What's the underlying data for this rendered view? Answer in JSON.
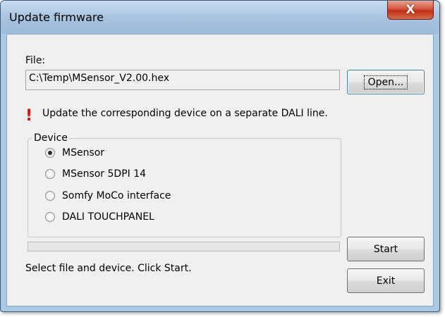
{
  "window": {
    "title": "Update firmware",
    "close_glyph": "X"
  },
  "file": {
    "label": "File:",
    "path": "C:\\Temp\\MSensor_V2.00.hex",
    "open_button": "Open..."
  },
  "warning": {
    "icon": "exclamation-icon",
    "text": "Update the corresponding device on a separate DALI line."
  },
  "device": {
    "group_label": "Device",
    "options": [
      "MSensor",
      "MSensor 5DPI 14",
      "Somfy MoCo interface",
      "DALI TOUCHPANEL"
    ],
    "selected": "MSensor"
  },
  "progress": {
    "fraction": 0
  },
  "status": {
    "text": "Select file and device. Click Start."
  },
  "buttons": {
    "start": "Start",
    "exit": "Exit"
  },
  "colors": {
    "close_button": "#c8391e",
    "warning_icon": "#e01010"
  }
}
